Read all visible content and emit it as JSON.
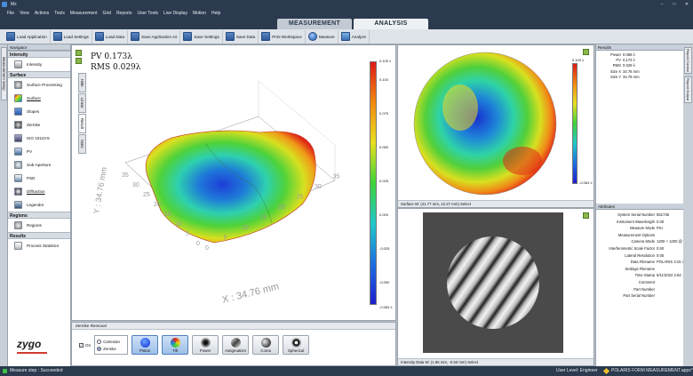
{
  "window": {
    "title": "Mx",
    "controls": [
      "–",
      "□",
      "✕"
    ]
  },
  "menu": [
    "File",
    "View",
    "Actions",
    "Tools",
    "Measurement",
    "Grid",
    "Reports",
    "User Tools",
    "Live Display",
    "Motion",
    "Help"
  ],
  "tabs": [
    {
      "label": "MEASUREMENT",
      "active": false
    },
    {
      "label": "ANALYSIS",
      "active": true
    }
  ],
  "toolbar": [
    "Load Application",
    "Load Settings",
    "Load Data",
    "Save Application As",
    "Save Settings",
    "Save Data",
    "Print Workspace",
    "Measure",
    "Analyze"
  ],
  "left_strip": {
    "label": "Measurement Setup"
  },
  "navigator": {
    "header": "Navigator",
    "sections": [
      {
        "title": "Intensity",
        "items": [
          "Intensity"
        ]
      },
      {
        "title": "Surface",
        "items": [
          "Surface Processing",
          "Surface",
          "Slopes",
          "Zernike",
          "ISO 10110-5",
          "PV",
          "Sub-Aperture",
          "PSD",
          "Diffraction",
          "Legendre"
        ]
      },
      {
        "title": "Regions",
        "items": [
          "Regions"
        ]
      },
      {
        "title": "Results",
        "items": [
          "Process Statistics"
        ]
      }
    ],
    "logo": "zygo"
  },
  "main": {
    "pv": "PV 0.173λ",
    "rms": "RMS 0.029λ",
    "vtabs": [
      "Hide",
      "Linear",
      "Result",
      "Stats"
    ],
    "y_axis": "Y : 34.76 mm",
    "x_axis": "X : 34.76 mm",
    "x_ticks": [
      "0",
      "5",
      "10",
      "15",
      "20",
      "25",
      "30",
      "35"
    ],
    "y_ticks": [
      "0",
      "5",
      "10",
      "15",
      "20",
      "25",
      "30",
      "35"
    ],
    "colorbar": {
      "max": "0.109 λ",
      "min": "-0.064 λ",
      "ticks": [
        "0.100",
        "0.075",
        "0.050",
        "0.025",
        "0.000",
        "-0.025",
        "-0.050"
      ]
    }
  },
  "surface_panel": {
    "colorbar": {
      "max": "0.109 λ",
      "min": "-0.064 λ"
    },
    "status": "Surface   W: (41.77 mm, 12.27 mm)   Select"
  },
  "intensity_panel": {
    "status": "Intensity Data   W: (1.86 mm, -0.50 mm)   Select"
  },
  "zernike": {
    "header": "Zernike Removal",
    "on_label": "On",
    "cartesian": "Cartesian",
    "zernike_label": "Zernike",
    "buttons": [
      "Piston",
      "Tilt",
      "Power",
      "Astigmatism",
      "Coma",
      "Spherical"
    ]
  },
  "results": {
    "header": "Results",
    "rows": [
      {
        "k": "Power",
        "v": "0.068",
        "u": "λ"
      },
      {
        "k": "PV",
        "v": "0.173",
        "u": "λ"
      },
      {
        "k": "RMS",
        "v": "0.029",
        "u": "λ"
      },
      {
        "k": "Size X",
        "v": "34.76",
        "u": "mm"
      },
      {
        "k": "Size Y",
        "v": "34.76",
        "u": "mm"
      }
    ]
  },
  "attributes": {
    "header": "Attributes",
    "rows": [
      {
        "k": "System Serial Number",
        "v": "651738"
      },
      {
        "k": "Instrument Wavelength",
        "v": "0.00"
      },
      {
        "k": "Measure Mode",
        "v": "PSI"
      },
      {
        "k": "Measurement Options",
        "v": ""
      },
      {
        "k": "Camera Mode",
        "v": "1200 × 1200 @"
      },
      {
        "k": "Interferometric Scale Factor",
        "v": "0.50"
      },
      {
        "k": "Lateral Resolution",
        "v": "0.05"
      },
      {
        "k": "Data Filename",
        "v": "POLARIS 4:15 7("
      },
      {
        "k": "Settings Filename",
        "v": ""
      },
      {
        "k": "Time Stamp",
        "v": "5/11/2022 2:54:"
      },
      {
        "k": "Comment",
        "v": ""
      },
      {
        "k": "Part Number",
        "v": ""
      },
      {
        "k": "Part Serial Number",
        "v": ""
      }
    ]
  },
  "far_right": [
    "Report Control",
    "Report Output"
  ],
  "status": {
    "left": "Measure step : Succeeded",
    "user": "User Level: Engineer",
    "app": "POLARIS FORM MEASUREMENT.appx*"
  }
}
